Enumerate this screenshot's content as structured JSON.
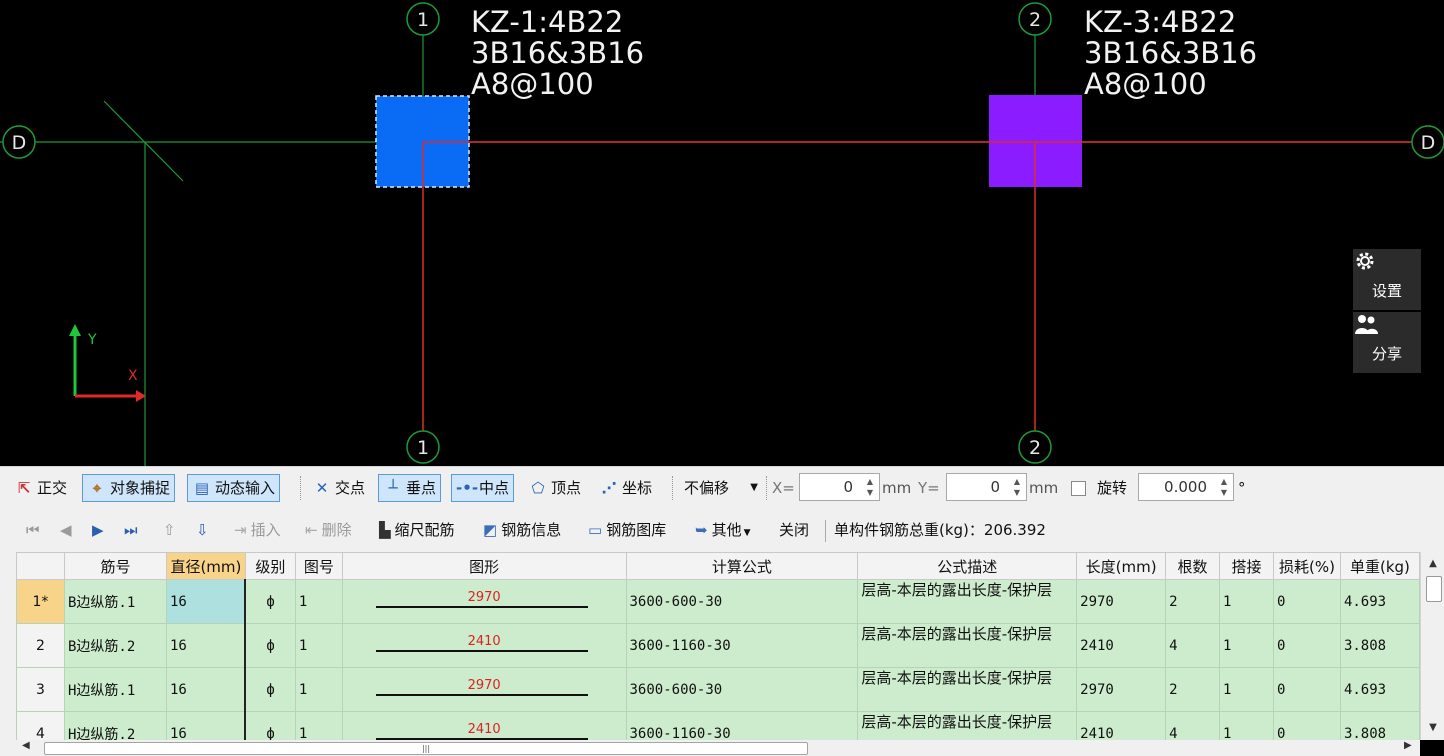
{
  "cad": {
    "axes": {
      "left_d": "D",
      "right_d": "D",
      "top_1": "1",
      "top_2": "2",
      "bottom_1": "1",
      "bottom_2": "2",
      "y": "Y",
      "x": "X"
    },
    "column1": {
      "line1": "KZ-1:4B22",
      "line2": "3B16&3B16",
      "line3": "A8@100",
      "color": "#0a6cf5"
    },
    "column2": {
      "line1": "KZ-3:4B22",
      "line2": "3B16&3B16",
      "line3": "A8@100",
      "color": "#8a1cff"
    },
    "side_buttons": {
      "settings": "设置",
      "share": "分享"
    }
  },
  "snap_toolbar": {
    "ortho": "正交",
    "object_snap": "对象捕捉",
    "dynamic_input": "动态输入",
    "intersection": "交点",
    "perpendicular": "垂点",
    "midpoint": "中点",
    "vertex": "顶点",
    "coordinate": "坐标",
    "offset_mode": "不偏移",
    "x_label": "X=",
    "x_value": "0",
    "x_unit": "mm",
    "y_label": "Y=",
    "y_value": "0",
    "y_unit": "mm",
    "rotate": "旋转",
    "rotate_value": "0.000",
    "degree": "°"
  },
  "rebar_toolbar": {
    "insert": "插入",
    "delete": "删除",
    "scale_rebar": "缩尺配筋",
    "rebar_info": "钢筋信息",
    "rebar_library": "钢筋图库",
    "other": "其他",
    "close": "关闭",
    "total_weight": "单构件钢筋总重(kg)：206.392"
  },
  "table": {
    "headers": [
      "",
      "筋号",
      "直径(mm)",
      "级别",
      "图号",
      "图形",
      "计算公式",
      "公式描述",
      "长度(mm)",
      "根数",
      "搭接",
      "损耗(%)",
      "单重(kg)"
    ],
    "rows": [
      {
        "idx": "1*",
        "name": "B边纵筋.1",
        "dia": "16",
        "grade": "ф",
        "fig": "1",
        "shape_val": "2970",
        "formula": "3600-600-30",
        "desc": "层高-本层的露出长度-保护层",
        "length": "2970",
        "count": "2",
        "lap": "1",
        "loss": "0",
        "weight": "4.693"
      },
      {
        "idx": "2",
        "name": "B边纵筋.2",
        "dia": "16",
        "grade": "ф",
        "fig": "1",
        "shape_val": "2410",
        "formula": "3600-1160-30",
        "desc": "层高-本层的露出长度-保护层",
        "length": "2410",
        "count": "4",
        "lap": "1",
        "loss": "0",
        "weight": "3.808"
      },
      {
        "idx": "3",
        "name": "H边纵筋.1",
        "dia": "16",
        "grade": "ф",
        "fig": "1",
        "shape_val": "2970",
        "formula": "3600-600-30",
        "desc": "层高-本层的露出长度-保护层",
        "length": "2970",
        "count": "2",
        "lap": "1",
        "loss": "0",
        "weight": "4.693"
      },
      {
        "idx": "4",
        "name": "H边纵筋.2",
        "dia": "16",
        "grade": "ф",
        "fig": "1",
        "shape_val": "2410",
        "formula": "3600-1160-30",
        "desc": "层高-本层的露出长度-保护层",
        "length": "2410",
        "count": "4",
        "lap": "1",
        "loss": "0",
        "weight": "3.808"
      }
    ]
  }
}
